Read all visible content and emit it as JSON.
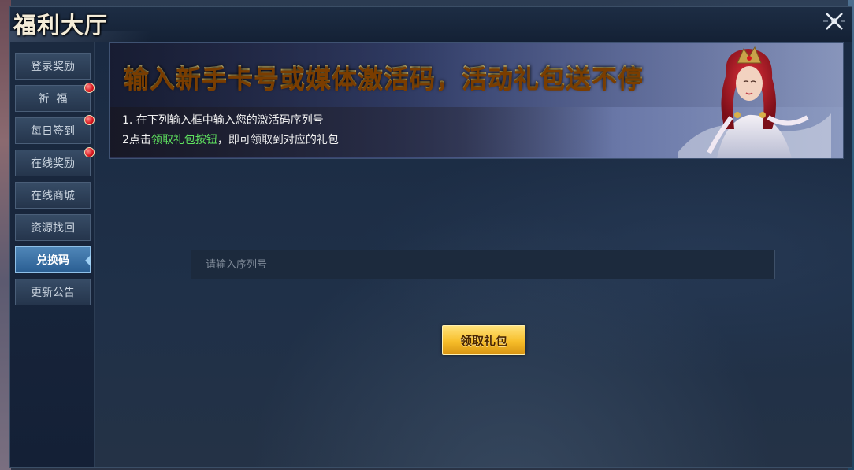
{
  "window": {
    "title": "福利大厅"
  },
  "sidebar": {
    "items": [
      {
        "label": "登录奖励",
        "badge": false,
        "active": false
      },
      {
        "label": "祈  福",
        "badge": true,
        "active": false
      },
      {
        "label": "每日签到",
        "badge": true,
        "active": false
      },
      {
        "label": "在线奖励",
        "badge": true,
        "active": false
      },
      {
        "label": "在线商城",
        "badge": false,
        "active": false
      },
      {
        "label": "资源找回",
        "badge": false,
        "active": false
      },
      {
        "label": "兑换码",
        "badge": false,
        "active": true
      },
      {
        "label": "更新公告",
        "badge": false,
        "active": false
      }
    ]
  },
  "banner": {
    "headline": "输入新手卡号或媒体激活码，活动礼包送不停",
    "step1": "1. 在下列输入框中输入您的激活码序列号",
    "step2_prefix": "2点击",
    "step2_highlight": "领取礼包按钮",
    "step2_suffix": "，即可领取到对应的礼包"
  },
  "redeem": {
    "input_value": "",
    "input_placeholder": "请输入序列号",
    "claim_label": "领取礼包"
  },
  "colors": {
    "accent_gold": "#f7be2a",
    "highlight_green": "#5fe35f",
    "badge_red": "#d8161e",
    "active_tab": "#4f86b8"
  }
}
